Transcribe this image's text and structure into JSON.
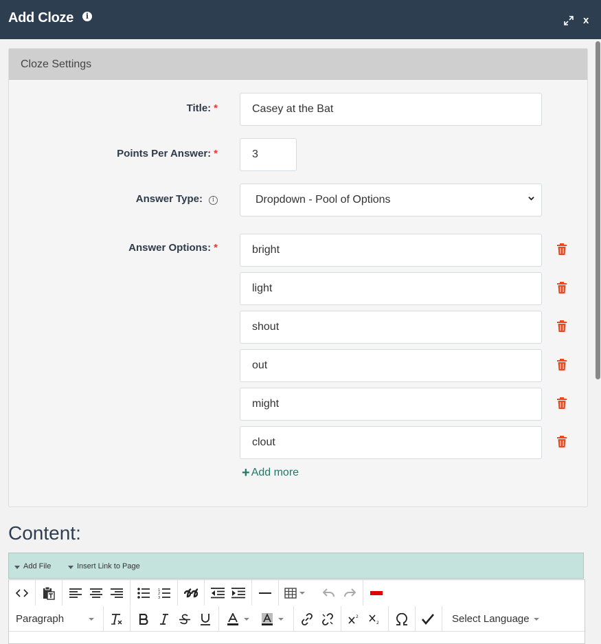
{
  "window": {
    "title": "Add Cloze",
    "close_label": "x"
  },
  "panel": {
    "heading": "Cloze Settings"
  },
  "form": {
    "title_label": "Title:",
    "title_value": "Casey at the Bat",
    "points_label": "Points Per Answer:",
    "points_value": "3",
    "answer_type_label": "Answer Type:",
    "answer_type_value": "Dropdown - Pool of Options",
    "answer_options_label": "Answer Options:",
    "required_mark": "*",
    "answer_options": [
      "bright",
      "light",
      "shout",
      "out",
      "might",
      "clout"
    ],
    "add_more_label": "Add more"
  },
  "content": {
    "heading": "Content:",
    "ribbon": {
      "add_file": "Add File",
      "insert_link": "Insert Link to Page"
    },
    "toolbar": {
      "paragraph": "Paragraph",
      "language": "Select Language"
    }
  },
  "colors": {
    "titlebar": "#2d3e50",
    "required": "#e03c2f",
    "trash": "#e8491d",
    "add_more": "#1e7a64",
    "ribbon": "#c4e3dc"
  },
  "icons": [
    "info-icon",
    "expand-icon",
    "close-icon",
    "trash-icon",
    "plus-icon",
    "code-icon",
    "paste-text-icon",
    "align-left-icon",
    "align-center-icon",
    "align-right-icon",
    "bullet-list-icon",
    "numbered-list-icon",
    "blockquote-icon",
    "outdent-icon",
    "indent-icon",
    "horizontal-rule-icon",
    "table-icon",
    "undo-icon",
    "redo-icon",
    "red-line-icon",
    "clear-format-icon",
    "bold-icon",
    "italic-icon",
    "strikethrough-icon",
    "underline-icon",
    "text-color-icon",
    "background-color-icon",
    "link-icon",
    "unlink-icon",
    "superscript-icon",
    "subscript-icon",
    "omega-icon",
    "checkmark-icon"
  ]
}
